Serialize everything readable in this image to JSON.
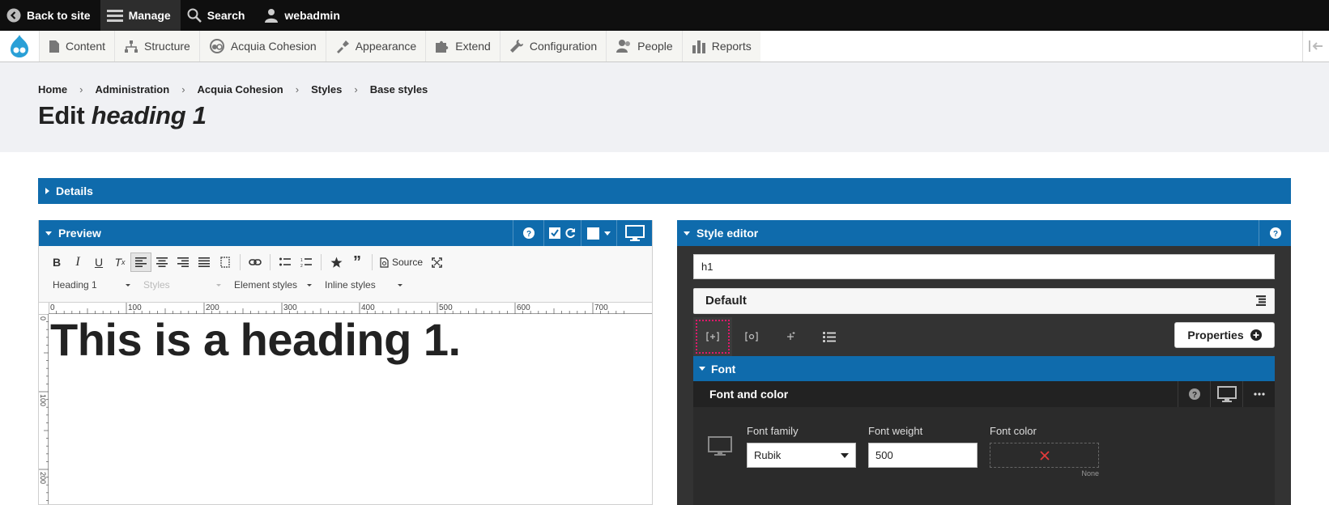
{
  "toolbar": {
    "back_label": "Back to site",
    "manage_label": "Manage",
    "search_label": "Search",
    "user_label": "webadmin"
  },
  "tray": {
    "items": [
      {
        "label": "Content",
        "icon": "page-icon"
      },
      {
        "label": "Structure",
        "icon": "structure-icon"
      },
      {
        "label": "Acquia Cohesion",
        "icon": "cohesion-icon"
      },
      {
        "label": "Appearance",
        "icon": "brush-icon"
      },
      {
        "label": "Extend",
        "icon": "puzzle-icon"
      },
      {
        "label": "Configuration",
        "icon": "wrench-icon"
      },
      {
        "label": "People",
        "icon": "people-icon"
      },
      {
        "label": "Reports",
        "icon": "bar-chart-icon"
      }
    ]
  },
  "breadcrumb": [
    "Home",
    "Administration",
    "Acquia Cohesion",
    "Styles",
    "Base styles"
  ],
  "page_title": {
    "prefix": "Edit",
    "name": "heading 1"
  },
  "details_label": "Details",
  "preview": {
    "title": "Preview",
    "source_label": "Source",
    "format_combo": "Heading 1",
    "styles_combo": "Styles",
    "element_styles_combo": "Element styles",
    "inline_styles_combo": "Inline styles",
    "ruler_h_labels": [
      "0",
      "100",
      "200",
      "300",
      "400",
      "500",
      "600",
      "700"
    ],
    "ruler_v_labels": [
      "0",
      "100",
      "200"
    ],
    "sample_text": "This is a heading 1."
  },
  "style_editor": {
    "title": "Style editor",
    "selector_value": "h1",
    "default_label": "Default",
    "properties_label": "Properties",
    "font_section": "Font",
    "font_color_group": "Font and color",
    "font_family_label": "Font family",
    "font_family_value": "Rubik",
    "font_weight_label": "Font weight",
    "font_weight_value": "500",
    "font_color_label": "Font color",
    "font_color_none": "None"
  },
  "colors": {
    "admin_bar": "#0f0f0f",
    "accent_blue": "#0f6bac",
    "editor_bg": "#333333",
    "selection_outline": "#e0196a",
    "clear_red": "#e33b3b"
  }
}
